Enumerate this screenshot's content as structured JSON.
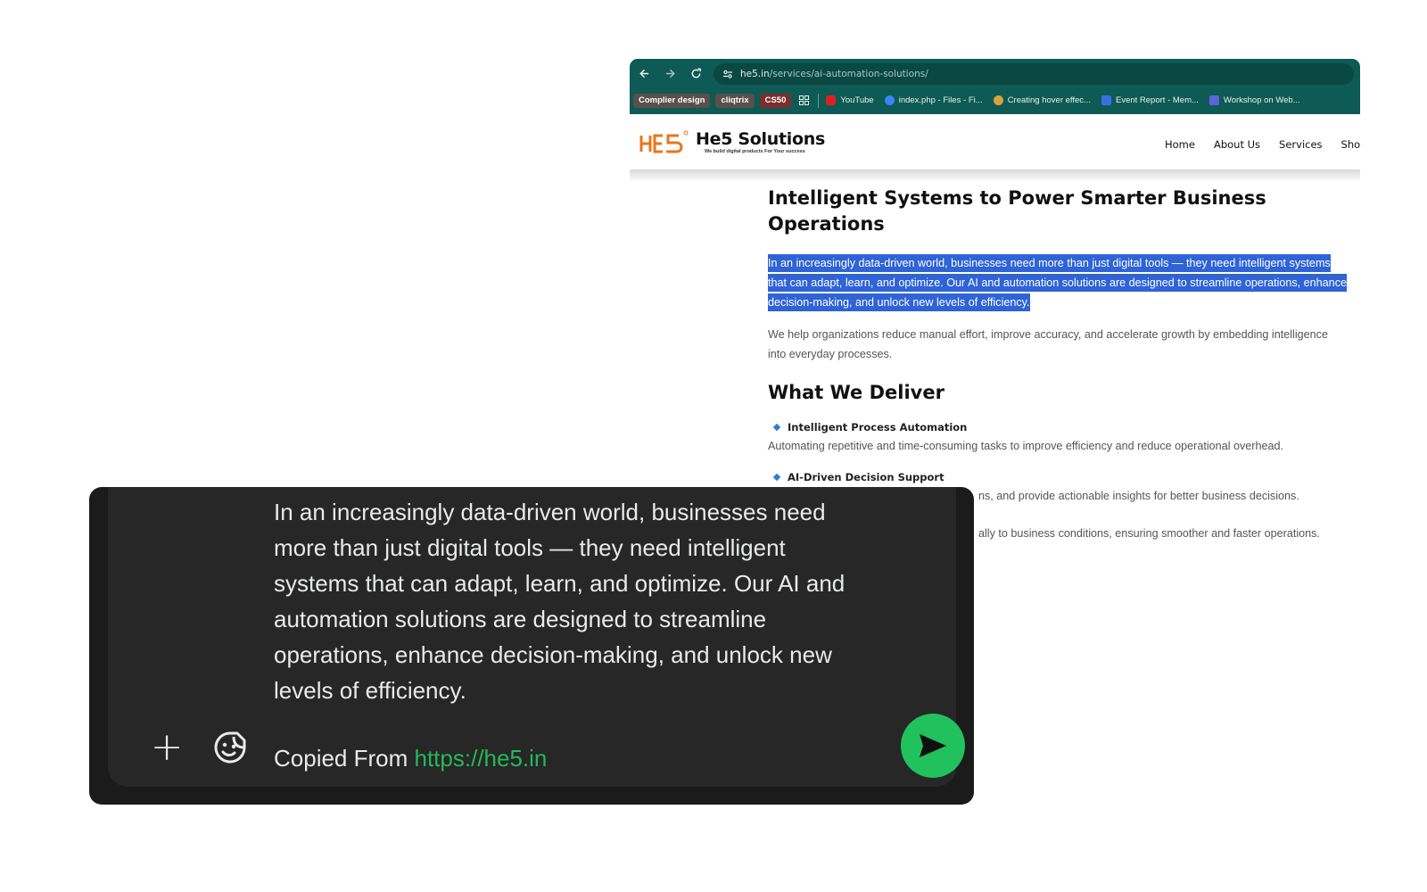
{
  "browser": {
    "url_host": "he5.in",
    "url_path": "/services/ai-automation-solutions/",
    "bookmarks": [
      {
        "label": "Complier design",
        "kind": "chip"
      },
      {
        "label": "cliqtrix",
        "kind": "chip"
      },
      {
        "label": "CS50",
        "kind": "chip"
      },
      {
        "label": "YouTube",
        "kind": "link",
        "color": "#e02020"
      },
      {
        "label": "index.php - Files - Fi...",
        "kind": "link",
        "color": "#3b82f6"
      },
      {
        "label": "Creating hover effec...",
        "kind": "link",
        "color": "#d9a33a"
      },
      {
        "label": "Event Report - Mem...",
        "kind": "link",
        "color": "#3b6fe0"
      },
      {
        "label": "Workshop on Web...",
        "kind": "link",
        "color": "#5d63d8"
      }
    ]
  },
  "site": {
    "logo_title": "He5 Solutions",
    "logo_tagline": "We build digital products For Your success",
    "nav": [
      "Home",
      "About Us",
      "Services",
      "Shop"
    ],
    "heading": "Intelligent Systems to Power Smarter Business Operations",
    "selected_paragraph": "In an increasingly data-driven world, businesses need more than just digital tools — they need intelligent systems that can adapt, learn, and optimize. Our AI and automation solutions are designed to streamline operations, enhance decision-making, and unlock new levels of efficiency.",
    "paragraph": "We help organizations reduce manual effort, improve accuracy, and accelerate growth by embedding intelligence into everyday processes.",
    "deliver_heading": "What We Deliver",
    "deliver_items": [
      {
        "title": "Intelligent Process Automation",
        "desc": "Automating repetitive and time-consuming tasks to improve efficiency and reduce operational overhead."
      },
      {
        "title": "AI-Driven Decision Support",
        "desc": "ns, and provide actionable insights for better business decisions."
      },
      {
        "title": "",
        "desc": "ally to business conditions, ensuring smoother and faster operations."
      }
    ]
  },
  "composer": {
    "message": "In an increasingly data-driven world, businesses need more than just digital tools — they need intelligent systems that can adapt, learn, and optimize. Our AI and automation solutions are designed to streamline operations, enhance decision-making, and unlock new levels of efficiency.",
    "copied_prefix": "Copied From ",
    "copied_link": "https://he5.in",
    "send_color": "#21c15d"
  }
}
